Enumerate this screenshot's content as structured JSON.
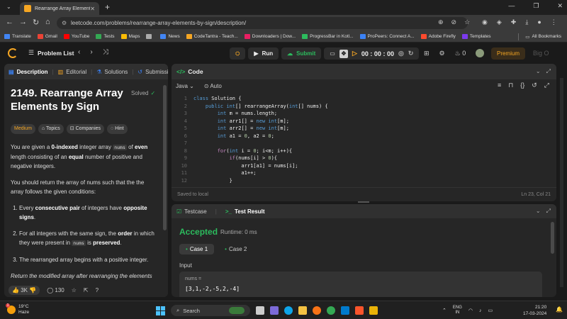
{
  "browser": {
    "tab_title": "Rearrange Array Elements by Si",
    "url": "leetcode.com/problems/rearrange-array-elements-by-sign/description/",
    "bookmarks": [
      {
        "label": "Translate",
        "color": "#4285f4"
      },
      {
        "label": "Gmail",
        "color": "#ea4335"
      },
      {
        "label": "YouTube",
        "color": "#ff0000"
      },
      {
        "label": "Tests",
        "color": "#34a853"
      },
      {
        "label": "Maps",
        "color": "#fbbc05"
      },
      {
        "label": "",
        "color": "#aaaaaa"
      },
      {
        "label": "News",
        "color": "#4285f4"
      },
      {
        "label": "CodeTantra - Teach...",
        "color": "#f5a623"
      },
      {
        "label": "Downloaders | Dow...",
        "color": "#e91e63"
      },
      {
        "label": "ProgressBar in Kotl...",
        "color": "#2cbb5d"
      },
      {
        "label": "ProPeers: Connect A...",
        "color": "#3b82f6"
      },
      {
        "label": "Adobe Firefly",
        "color": "#ff4a2d"
      },
      {
        "label": "Templates",
        "color": "#7c3aed"
      }
    ],
    "all_bookmarks": "All Bookmarks"
  },
  "nav": {
    "problem_list": "Problem List",
    "run": "Run",
    "submit": "Submit",
    "timer": "00 : 00 : 00",
    "streak": "0",
    "premium": "Premium",
    "big_o": "Big O"
  },
  "left": {
    "tabs": [
      "Description",
      "Editorial",
      "Solutions",
      "Submissions"
    ],
    "title": "2149. Rearrange Array Elements by Sign",
    "solved": "Solved",
    "tags": [
      "Medium",
      "Topics",
      "Companies",
      "Hint"
    ],
    "likes": "3K",
    "comments": "130"
  },
  "code": {
    "title": "Code",
    "language": "Java",
    "mode": "Auto",
    "saved": "Saved to local",
    "position": "Ln 23, Col 21"
  },
  "result": {
    "tabs": [
      "Testcase",
      "Test Result"
    ],
    "status": "Accepted",
    "runtime": "Runtime: 0 ms",
    "cases": [
      "Case 1",
      "Case 2"
    ],
    "input_label": "Input",
    "var_name": "nums =",
    "var_value": "[3,1,-2,-5,2,-4]"
  },
  "taskbar": {
    "temp": "19°C",
    "weather": "Haze",
    "search": "Search",
    "lang1": "ENG",
    "lang2": "IN",
    "time": "21:20",
    "date": "17-03-2024",
    "badge": "1"
  }
}
